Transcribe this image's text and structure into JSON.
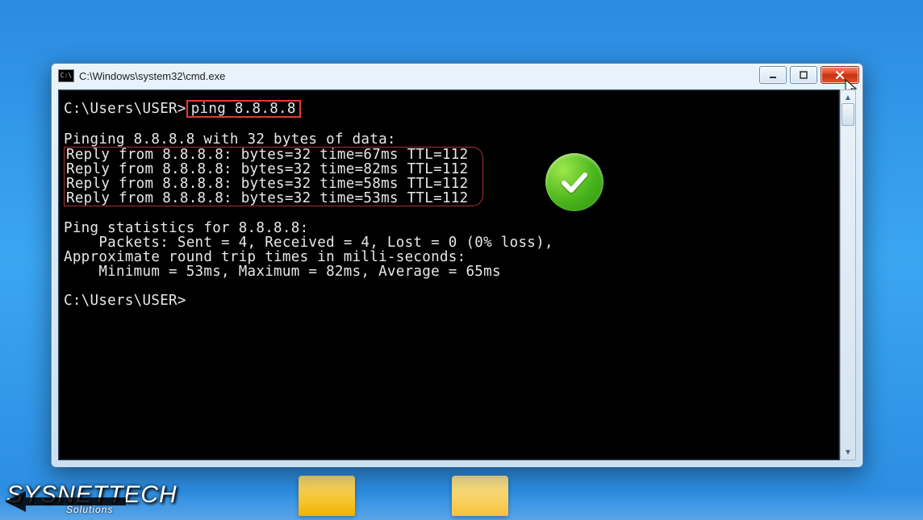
{
  "window": {
    "title": "C:\\Windows\\system32\\cmd.exe",
    "cmd_icon_text": "C:\\"
  },
  "terminal": {
    "prompt1_prefix": "C:\\Users\\USER>",
    "command": "ping 8.8.8.8",
    "ping_header": "Pinging 8.8.8.8 with 32 bytes of data:",
    "replies": [
      "Reply from 8.8.8.8: bytes=32 time=67ms TTL=112",
      "Reply from 8.8.8.8: bytes=32 time=82ms TTL=112",
      "Reply from 8.8.8.8: bytes=32 time=58ms TTL=112",
      "Reply from 8.8.8.8: bytes=32 time=53ms TTL=112"
    ],
    "stats_header": "Ping statistics for 8.8.8.8:",
    "stats_packets": "    Packets: Sent = 4, Received = 4, Lost = 0 (0% loss),",
    "rtt_header": "Approximate round trip times in milli-seconds:",
    "rtt_values": "    Minimum = 53ms, Maximum = 82ms, Average = 65ms",
    "prompt2": "C:\\Users\\USER>"
  },
  "branding": {
    "name": "SYSNETTECH",
    "sub": "Solutions"
  }
}
